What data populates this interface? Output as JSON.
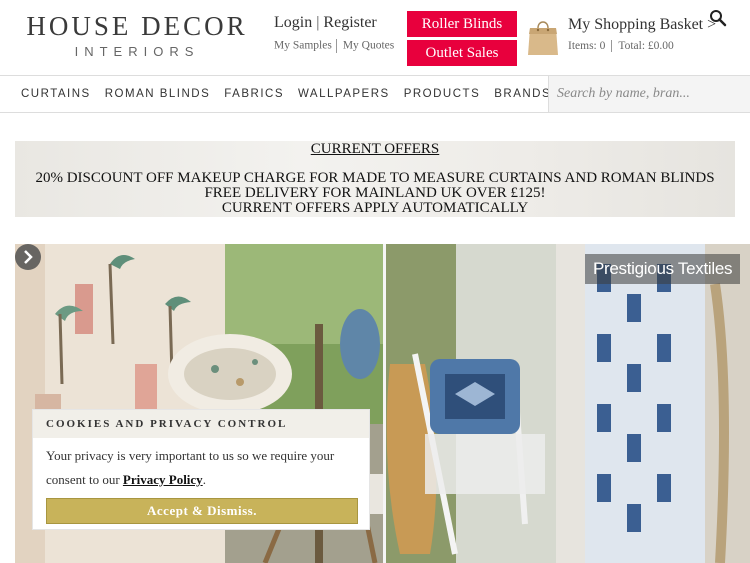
{
  "logo": {
    "main": "HOUSE DECOR",
    "sub": "INTERIORS"
  },
  "account": {
    "login": "Login",
    "separator": "|",
    "register": "Register",
    "my_samples": "My Samples",
    "my_quotes": "My Quotes"
  },
  "promos": {
    "roller_blinds": "Roller Blinds",
    "outlet_sales": "Outlet Sales"
  },
  "basket": {
    "title": "My Shopping Basket >",
    "items": "Items: 0",
    "total": "Total: £0.00"
  },
  "nav": {
    "items": [
      "CURTAINS",
      "ROMAN BLINDS",
      "FABRICS",
      "WALLPAPERS",
      "PRODUCTS",
      "BRANDS"
    ]
  },
  "search": {
    "placeholder": "Search by name, bran..."
  },
  "offers": {
    "title": "CURRENT OFFERS",
    "line1": "20% DISCOUNT OFF MAKEUP CHARGE FOR MADE TO MEASURE CURTAINS AND ROMAN BLINDS",
    "line2": "FREE DELIVERY  FOR MAINLAND UK OVER £125!",
    "line3": "CURRENT OFFERS APPLY AUTOMATICALLY"
  },
  "hero": {
    "caption": "Prestigious Textiles"
  },
  "cookie": {
    "heading": "COOKIES AND PRIVACY CONTROL",
    "text_before": "Your privacy is very important to us so we require your consent to our ",
    "link": "Privacy Policy",
    "text_after": ".",
    "button": "Accept & Dismiss."
  },
  "colors": {
    "promo": "#e8003d",
    "cookie_button": "#c8b35a"
  }
}
